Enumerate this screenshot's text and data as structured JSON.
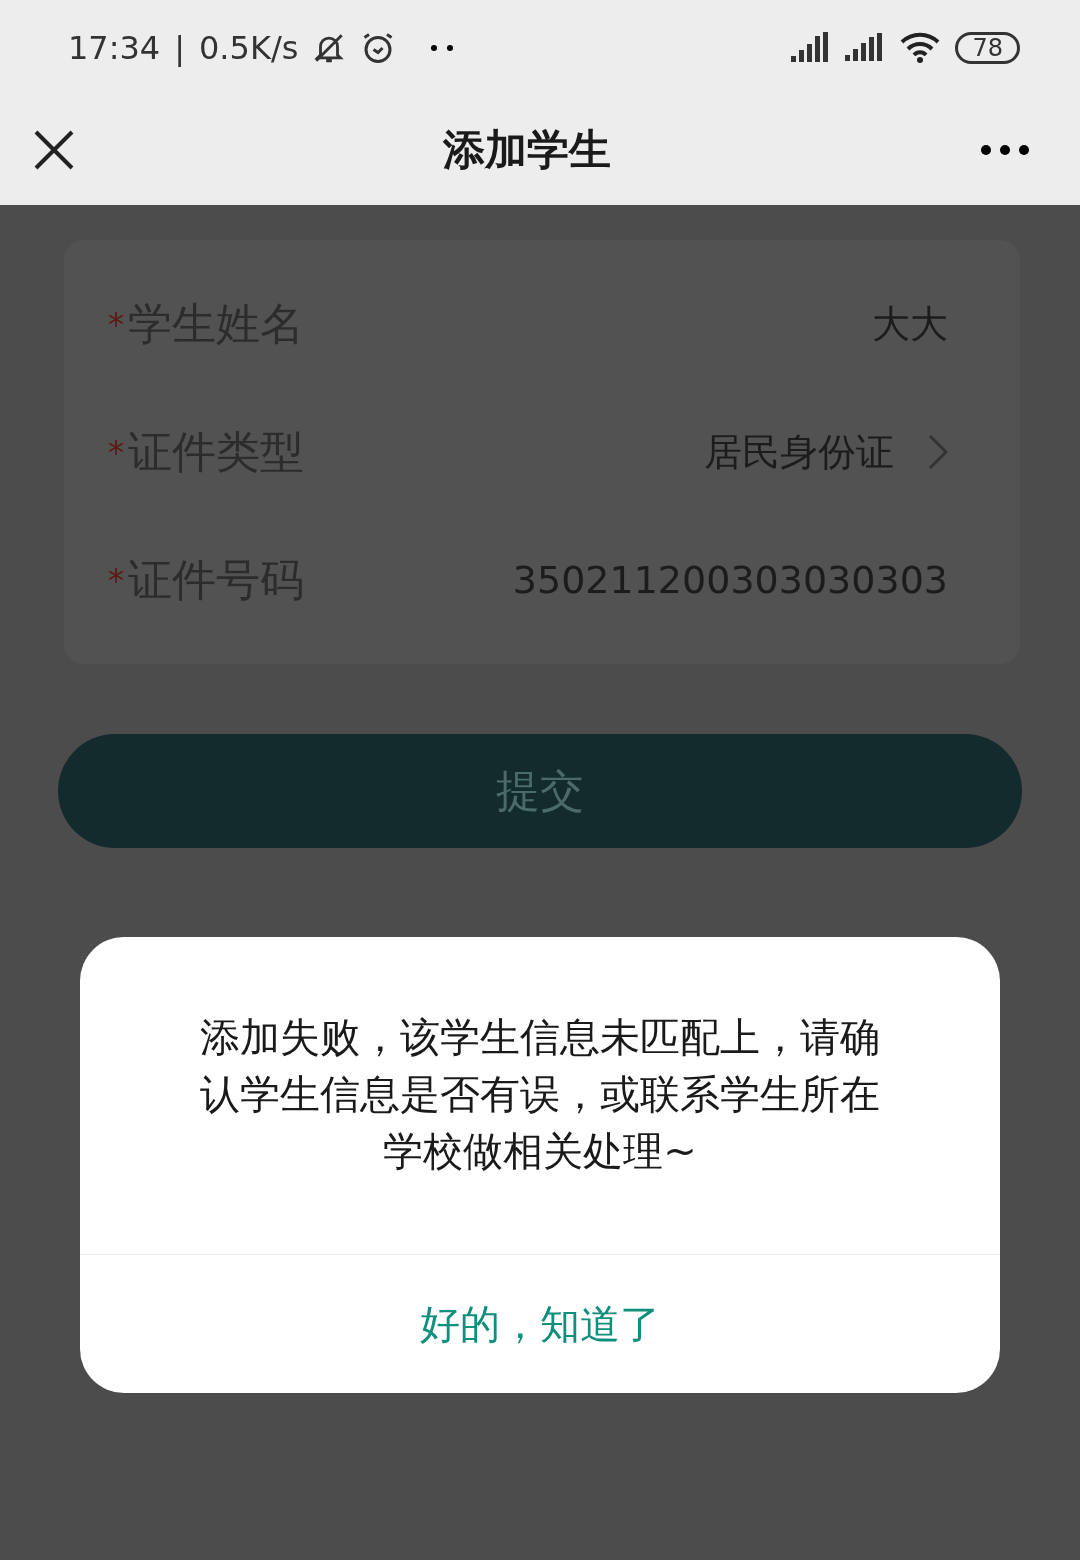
{
  "status_bar": {
    "time": "17:34",
    "separator": "|",
    "speed": "0.5K/s",
    "battery": "78"
  },
  "header": {
    "title": "添加学生"
  },
  "form": {
    "required_mark": "*",
    "rows": [
      {
        "label": "学生姓名",
        "required": true,
        "value": "大大",
        "kind": "text"
      },
      {
        "label": "证件类型",
        "required": true,
        "value": "居民身份证",
        "kind": "select"
      },
      {
        "label": "证件号码",
        "required": true,
        "value": "350211200303030303",
        "kind": "text"
      }
    ]
  },
  "submit": {
    "label": "提交",
    "disabled": true
  },
  "dialog": {
    "message": "添加失败，该学生信息未匹配上，请确认学生信息是否有误，或联系学生所在学校做相关处理~",
    "button": "好的，知道了"
  }
}
